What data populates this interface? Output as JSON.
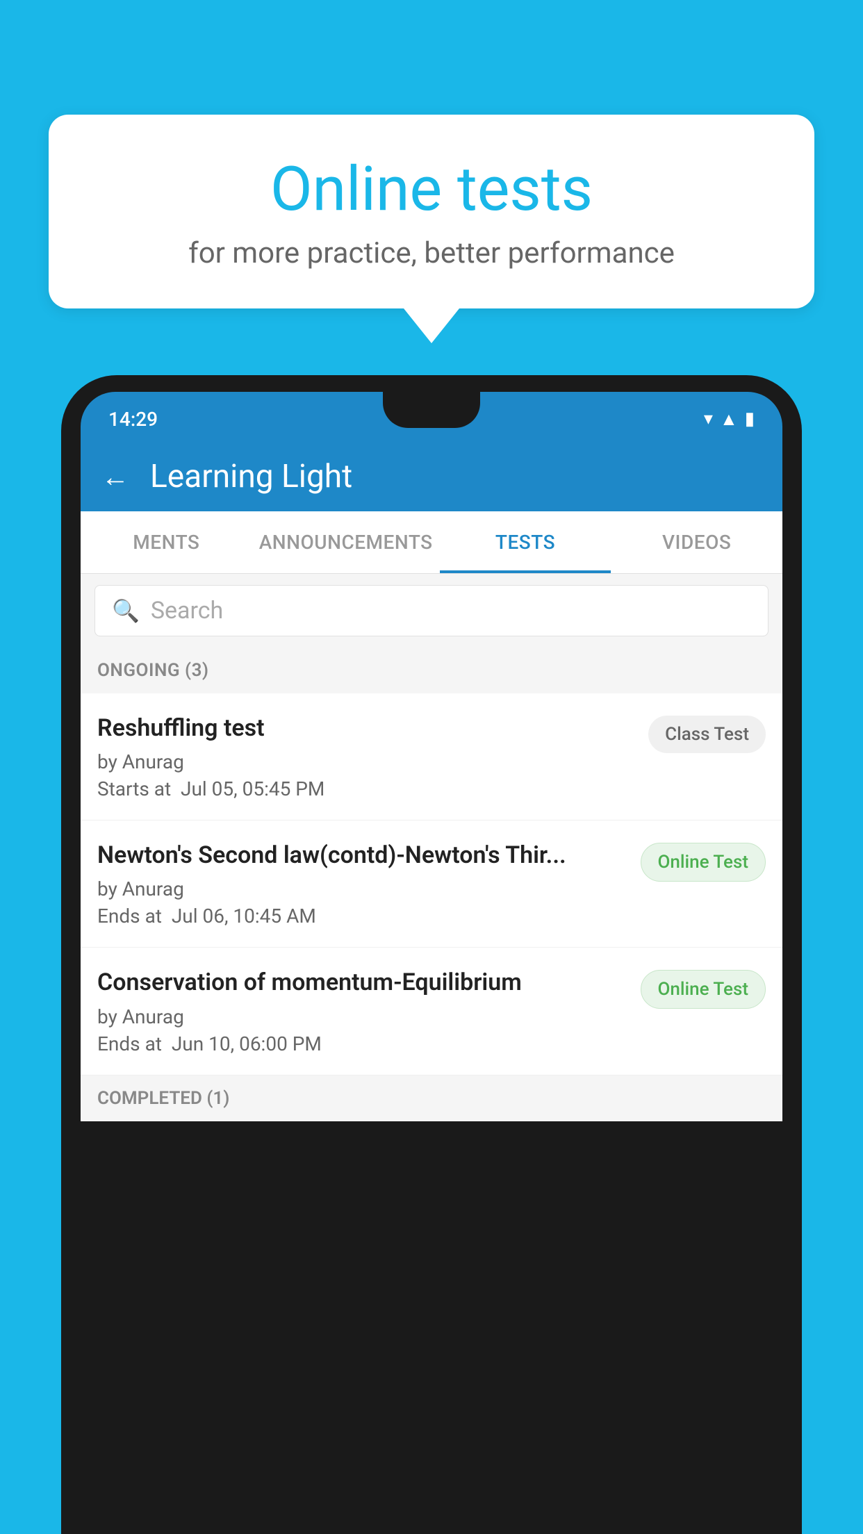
{
  "background_color": "#1ab7e8",
  "speech_bubble": {
    "title": "Online tests",
    "subtitle": "for more practice, better performance"
  },
  "phone": {
    "status_bar": {
      "time": "14:29",
      "wifi_icon": "▼",
      "signal_icon": "▲",
      "battery_icon": "▮"
    },
    "header": {
      "title": "Learning Light",
      "back_label": "←"
    },
    "tabs": [
      {
        "label": "MENTS",
        "active": false
      },
      {
        "label": "ANNOUNCEMENTS",
        "active": false
      },
      {
        "label": "TESTS",
        "active": true
      },
      {
        "label": "VIDEOS",
        "active": false
      }
    ],
    "search": {
      "placeholder": "Search"
    },
    "ongoing_section": {
      "header": "ONGOING (3)",
      "items": [
        {
          "name": "Reshuffling test",
          "author": "by Anurag",
          "date_label": "Starts at",
          "date": "Jul 05, 05:45 PM",
          "badge": "Class Test",
          "badge_type": "class"
        },
        {
          "name": "Newton's Second law(contd)-Newton's Thir...",
          "author": "by Anurag",
          "date_label": "Ends at",
          "date": "Jul 06, 10:45 AM",
          "badge": "Online Test",
          "badge_type": "online"
        },
        {
          "name": "Conservation of momentum-Equilibrium",
          "author": "by Anurag",
          "date_label": "Ends at",
          "date": "Jun 10, 06:00 PM",
          "badge": "Online Test",
          "badge_type": "online"
        }
      ]
    },
    "completed_section": {
      "header": "COMPLETED (1)"
    }
  }
}
